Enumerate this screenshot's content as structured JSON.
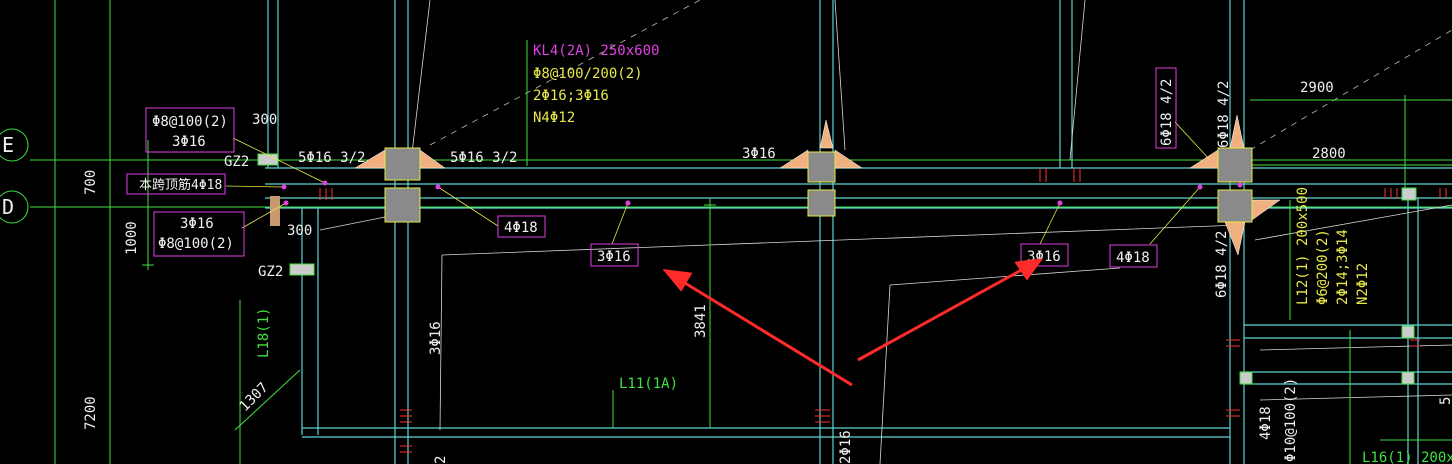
{
  "axes": {
    "e": "E",
    "d": "D"
  },
  "dims": {
    "d700": "700",
    "d1000": "1000",
    "d7200": "7200",
    "d300a": "300",
    "d300b": "300",
    "d2900": "2900",
    "d2800": "2800",
    "d3841": "3841",
    "d1307": "1307"
  },
  "kl4": {
    "line1": "KL4(2A) 250x600",
    "line2": "Φ8@100/200(2)",
    "line3": "2Φ16;3Φ16",
    "line4": "N4Φ12"
  },
  "left_upper_box": {
    "line1": "Φ8@100(2)",
    "line2": "3Φ16"
  },
  "left_mid_box": "本跨顶筋4Φ18",
  "left_lower_box": {
    "line1": "3Φ16",
    "line2": "Φ8@100(2)"
  },
  "gz_labels": {
    "upper": "GZ2",
    "lower": "GZ2"
  },
  "top_rebar": {
    "a": "5Φ16 3/2",
    "b": "5Φ16 3/2",
    "c": "3Φ16"
  },
  "bottom_boxes": {
    "a": "4Φ18",
    "b": "3Φ16",
    "c": "3Φ16",
    "d": "4Φ18"
  },
  "right_vertical": {
    "top_box": "6Φ18 4/2",
    "top_plain": "6Φ18 4/2",
    "bottom_plain": "6Φ18 4/2"
  },
  "l12": {
    "line1": "L12(1) 200x500",
    "line2": "Φ6@200(2)",
    "line3": "2Φ14;3Φ14",
    "line4": "N2Φ12"
  },
  "beam_labels": {
    "l18": "L18(1)",
    "l11": "L11(1A)",
    "l16": "L16(1) 200x"
  },
  "misc": {
    "v3phi16": "3Φ16",
    "v2phi16": "2Φ16",
    "v2": "2",
    "v4phi18": "4Φ18",
    "v10": "Φ10@100(2)",
    "v5": "5"
  },
  "colors": {
    "background": "#000000",
    "cyan": "#5fd3d3",
    "magenta": "#e040e0",
    "yellow": "#e8e84a",
    "green": "#40e040",
    "red": "#ff3030",
    "arrow": "#ff2a2a"
  }
}
